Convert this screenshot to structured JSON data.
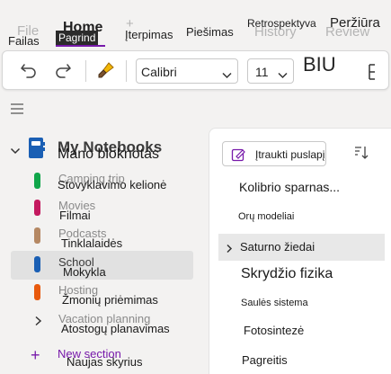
{
  "ribbon": {
    "ghost_tabs": [
      "File",
      "Home",
      "+",
      "History",
      "Review"
    ],
    "tabs": [
      "Failas",
      "Pagrindinis",
      "Įterpimas",
      "Piešimas",
      "Retrospektyva",
      "Peržiūra"
    ],
    "tab_file": "Failas",
    "tab_home": "Pagrind",
    "tab_home_bold": "Home",
    "tab_insert": "Įterpimas",
    "tab_draw": "Piešimas",
    "tab_history": "Retrospektyva",
    "tab_review": "Peržiūra",
    "ghost_file": "File",
    "ghost_history": "History",
    "ghost_review": "Review",
    "accent": "#7719aa"
  },
  "toolbar": {
    "icons": [
      "undo-icon",
      "redo-icon",
      "format-painter-icon",
      "chevron-down-icon",
      "list-icon"
    ],
    "font_name": "Calibri",
    "font_size": "11",
    "biu": "BIU"
  },
  "notebook": {
    "title": "Mano bloknotas",
    "ghost_title": "My Notebooks",
    "sections": [
      {
        "ghost": "Camping trip",
        "label": "Stovyklavimo kelionė",
        "color": "#10a64a"
      },
      {
        "ghost": "Movies",
        "label": "Filmai",
        "color": "#c4195f"
      },
      {
        "ghost": "Podcasts",
        "label": "Tinklalaidės",
        "color": "#b58863"
      },
      {
        "ghost": "School",
        "label": "Mokykla",
        "color": "#1a5fb4"
      },
      {
        "ghost": "Hosting",
        "label": "Žmonių priėmimas",
        "color": "#e8590c"
      },
      {
        "ghost": "Vacation planning",
        "label": "Atostogų planavimas",
        "color": ""
      }
    ],
    "new_section_ghost": "New section",
    "new_section_label": "Naujas skyrius"
  },
  "pages": {
    "add_page_label": "Įtraukti puslapį",
    "items": [
      {
        "label": "Kolibrio sparnas..."
      },
      {
        "label": "Orų modeliai"
      },
      {
        "label": "Saturno žiedai"
      },
      {
        "label": "Skrydžio fizika"
      },
      {
        "label": "Saulės sistema"
      },
      {
        "label": "Fotosintezė"
      },
      {
        "label": "Pagreitis"
      }
    ]
  }
}
